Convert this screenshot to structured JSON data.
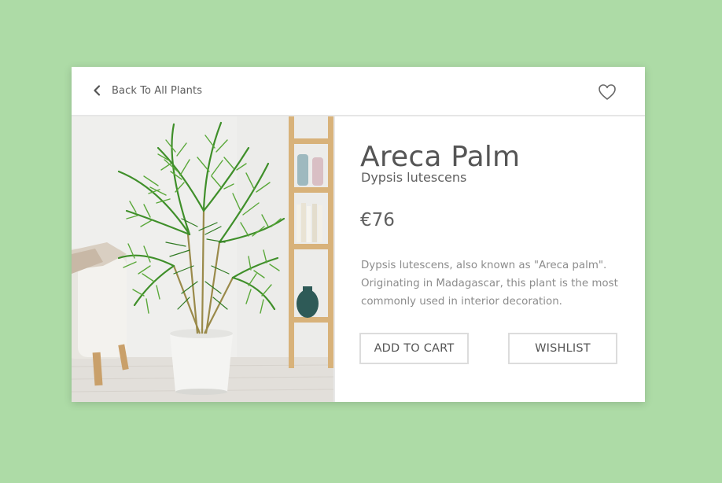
{
  "header": {
    "back_label": "Back To All Plants",
    "back_icon": "chevron-left-icon",
    "favorite_icon": "heart-outline-icon"
  },
  "product": {
    "name": "Areca Palm",
    "latin_name": "Dypsis lutescens",
    "price": "€76",
    "description": "Dypsis lutescens, also known as \"Areca palm\". Originating in Madagascar, this plant is the most commonly used in interior decoration.",
    "image_alt": "Areca palm in a white pot next to an armchair and a wooden bookshelf"
  },
  "actions": {
    "add_to_cart_label": "ADD TO CART",
    "wishlist_label": "WISHLIST"
  },
  "colors": {
    "page_background": "#addba6",
    "card_background": "#ffffff",
    "text_primary": "#555555",
    "text_secondary": "#8c8c8c",
    "button_border": "#dcdcdc"
  }
}
